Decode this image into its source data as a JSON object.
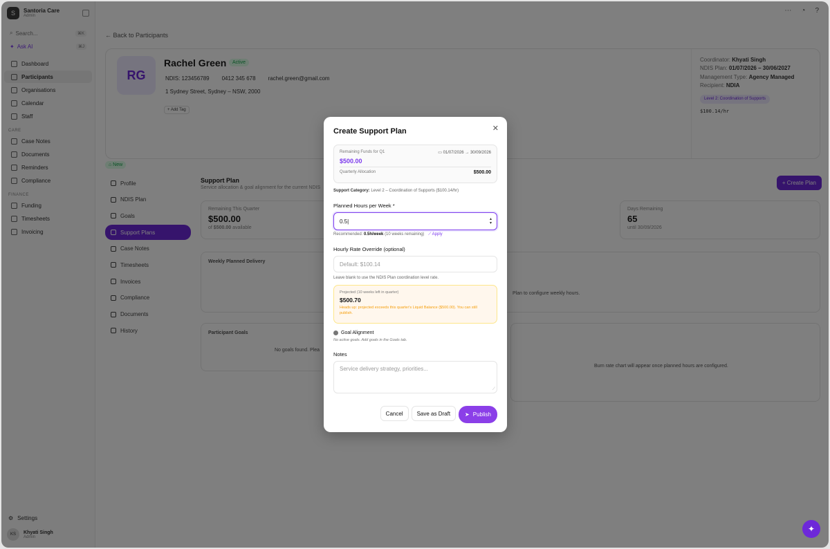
{
  "app": {
    "name": "Santoria Care",
    "subtitle": "Admin"
  },
  "sidebar": {
    "search_label": "Search...",
    "search_shortcut": "⌘K",
    "ask_label": "Ask AI",
    "ask_shortcut": "⌘J",
    "items": [
      {
        "label": "Dashboard"
      },
      {
        "label": "Participants"
      },
      {
        "label": "Organisations"
      },
      {
        "label": "Calendar"
      },
      {
        "label": "Staff"
      }
    ],
    "care_section": "CARE",
    "care_items": [
      {
        "label": "Case Notes"
      },
      {
        "label": "Documents"
      },
      {
        "label": "Reminders"
      },
      {
        "label": "Compliance"
      }
    ],
    "finance_section": "FINANCE",
    "finance_items": [
      {
        "label": "Funding"
      },
      {
        "label": "Timesheets"
      },
      {
        "label": "Invoicing"
      }
    ],
    "settings_label": "Settings",
    "user": {
      "initials": "KS",
      "name": "Khyati Singh",
      "role": "Admin"
    }
  },
  "page": {
    "back_label": "← Back to Participants",
    "participant": {
      "initials": "RG",
      "name": "Rachel Green",
      "status": "Active",
      "ndis": "NDIS: 123456789",
      "phone": "0412 345 678",
      "email": "rachel.green@gmail.com",
      "address": "1 Sydney Street, Sydney – NSW, 2000",
      "add_tag": "+ Add Tag"
    },
    "meta": {
      "coordinator_label": "Coordinator:",
      "coordinator": "Khyati Singh",
      "plan_label": "NDIS Plan:",
      "plan": "01/07/2026 – 30/06/2027",
      "mgmt_label": "Management Type:",
      "mgmt": "Agency Managed",
      "recipient_label": "Recipient:",
      "recipient": "NDIA",
      "level": "Level 2: Coordination of Supports",
      "rate": "$100.14/hr"
    },
    "new_badge": "⌂ New",
    "subnav": [
      {
        "label": "Profile"
      },
      {
        "label": "NDIS Plan"
      },
      {
        "label": "Goals"
      },
      {
        "label": "Support Plans"
      },
      {
        "label": "Case Notes"
      },
      {
        "label": "Timesheets"
      },
      {
        "label": "Invoices"
      },
      {
        "label": "Compliance"
      },
      {
        "label": "Documents"
      },
      {
        "label": "History"
      }
    ],
    "support_plan_title": "Support Plan",
    "support_plan_sub": "Service allocation & goal alignment for the current NDIS",
    "create_plan": "+ Create Plan",
    "stat1_label": "Remaining This Quarter",
    "stat1_value": "$500.00",
    "stat1_note_prefix": "of",
    "stat1_note_amount": "$500.00",
    "stat1_note_suffix": "available",
    "stat2_label": "Days Remaining",
    "stat2_value": "65",
    "stat2_note": "until 30/09/2026",
    "weekly_title": "Weekly Planned Delivery",
    "weekly_note": "Plan to configure weekly hours.",
    "goals_title": "Participant Goals",
    "goals_note": "No goals found. Plea",
    "burn_note": "Burn rate chart will appear once planned hours are configured."
  },
  "modal": {
    "title": "Create Support Plan",
    "funds_label": "Remaining Funds for Q1",
    "funds_dates": "01/07/2026 → 30/09/2026",
    "funds_amount": "$500.00",
    "quarterly_label": "Quarterly Allocation",
    "quarterly_value": "$500.00",
    "support_category_label": "Support Category:",
    "support_category": "Level 2 – Coordination of Supports ($100.14/hr)",
    "hours_label": "Planned Hours per Week *",
    "hours_value": "0.5",
    "recommended_prefix": "Recommended:",
    "recommended_value": "0.5h/week",
    "recommended_suffix": "(10 weeks remaining)",
    "apply_label": "Apply",
    "rate_label": "Hourly Rate Override (optional)",
    "rate_placeholder": "Default: $100.14",
    "rate_hint": "Leave blank to use the NDIS Plan coordination level rate.",
    "projected_label": "Projected (10 weeks left in quarter)",
    "projected_value": "$500.70",
    "projected_warning": "Heads up: projected exceeds this quarter's Liquid Balance ($500.00). You can still publish.",
    "goal_label": "Goal Alignment",
    "goal_note": "No active goals. Add goals in the Goals tab.",
    "notes_label": "Notes",
    "notes_placeholder": "Service delivery strategy, priorities...",
    "cancel": "Cancel",
    "save_draft": "Save as Draft",
    "publish": "Publish"
  },
  "colors": {
    "accent": "#7c3aed",
    "warning": "#f59e0b",
    "success": "#16a34a"
  }
}
